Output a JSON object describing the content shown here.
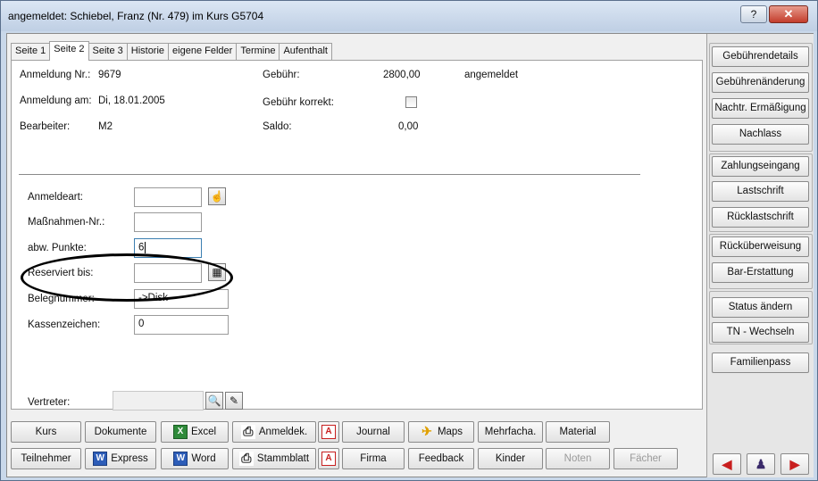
{
  "window": {
    "title": "angemeldet: Schiebel, Franz (Nr. 479) im Kurs G5704",
    "help_label": "?",
    "close_label": "✕"
  },
  "tabs": [
    "Seite 1",
    "Seite 2",
    "Seite 3",
    "Historie",
    "eigene Felder",
    "Termine",
    "Aufenthalt"
  ],
  "info": {
    "anmeldung_nr_label": "Anmeldung Nr.:",
    "anmeldung_nr": "9679",
    "anmeldung_am_label": "Anmeldung am:",
    "anmeldung_am": "Di, 18.01.2005",
    "bearbeiter_label": "Bearbeiter:",
    "bearbeiter": "M2",
    "gebuehr_label": "Gebühr:",
    "gebuehr": "2800,00",
    "status": "angemeldet",
    "gebuehr_korrekt_label": "Gebühr korrekt:",
    "saldo_label": "Saldo:",
    "saldo": "0,00"
  },
  "form": {
    "anmeldeart_label": "Anmeldeart:",
    "anmeldeart": "",
    "massnahmen_label": "Maßnahmen-Nr.:",
    "massnahmen": "",
    "abw_punkte_label": "abw. Punkte:",
    "abw_punkte": "6",
    "reserviert_label": "Reserviert bis:",
    "reserviert": "",
    "belegnummer_label": "Belegnummer:",
    "belegnummer": "->Disk",
    "kassenzeichen_label": "Kassenzeichen:",
    "kassenzeichen": "0",
    "vertreter_label": "Vertreter:",
    "vertreter": ""
  },
  "bottom_row1": {
    "kurs": "Kurs",
    "dokumente": "Dokumente",
    "excel": "Excel",
    "anmeldek": "Anmeldek.",
    "journal": "Journal",
    "maps": "Maps",
    "mehrfacha": "Mehrfacha.",
    "material": "Material"
  },
  "bottom_row2": {
    "teilnehmer": "Teilnehmer",
    "express": "Express",
    "word": "Word",
    "stammblatt": "Stammblatt",
    "firma": "Firma",
    "feedback": "Feedback",
    "kinder": "Kinder",
    "noten": "Noten",
    "faecher": "Fächer"
  },
  "side": {
    "gebuehrendetails": "Gebührendetails",
    "gebuehrenaenderung": "Gebührenänderung",
    "nachtr_ermaessigung": "Nachtr. Ermäßigung",
    "nachlass": "Nachlass",
    "zahlungseingang": "Zahlungseingang",
    "lastschrift": "Lastschrift",
    "ruecklastschrift": "Rücklastschrift",
    "rueckueberweisung": "Rücküberweisung",
    "bar_erstattung": "Bar-Erstattung",
    "status_aendern": "Status ändern",
    "tn_wechseln": "TN - Wechseln",
    "familienpass": "Familienpass"
  }
}
